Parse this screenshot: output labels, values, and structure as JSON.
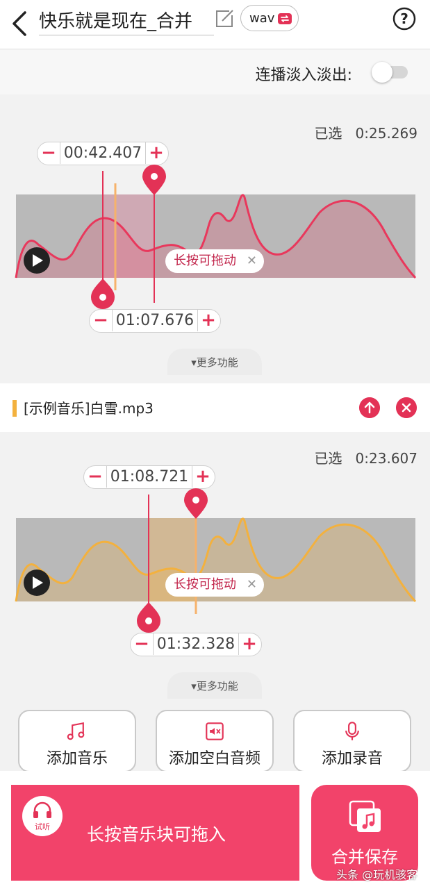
{
  "header": {
    "title": "快乐就是现在_合并",
    "format": "wav"
  },
  "crossfade": {
    "label": "连播淡入淡出:",
    "enabled": false
  },
  "tracks": [
    {
      "selected_label": "已选",
      "selected_duration": "0:25.269",
      "start_time": "00:42.407",
      "end_time": "01:07.676",
      "drag_hint": "长按可拖动",
      "more_label": "更多功能",
      "wave_color": "#e8385c"
    },
    {
      "name": "[示例音乐]白雪.mp3",
      "selected_label": "已选",
      "selected_duration": "0:23.607",
      "start_time": "01:08.721",
      "end_time": "01:32.328",
      "drag_hint": "长按可拖动",
      "more_label": "更多功能",
      "wave_color": "#f3b13e"
    }
  ],
  "actions": {
    "add_music": "添加音乐",
    "add_silence": "添加空白音频",
    "add_recording": "添加录音"
  },
  "bottom": {
    "listen": "试听",
    "drop_hint": "长按音乐块可拖入",
    "save": "合并保存"
  },
  "watermark": "头条 @玩机骇客",
  "colors": {
    "accent": "#f2436a",
    "accent_dark": "#e33256",
    "track2": "#f3b13e"
  }
}
